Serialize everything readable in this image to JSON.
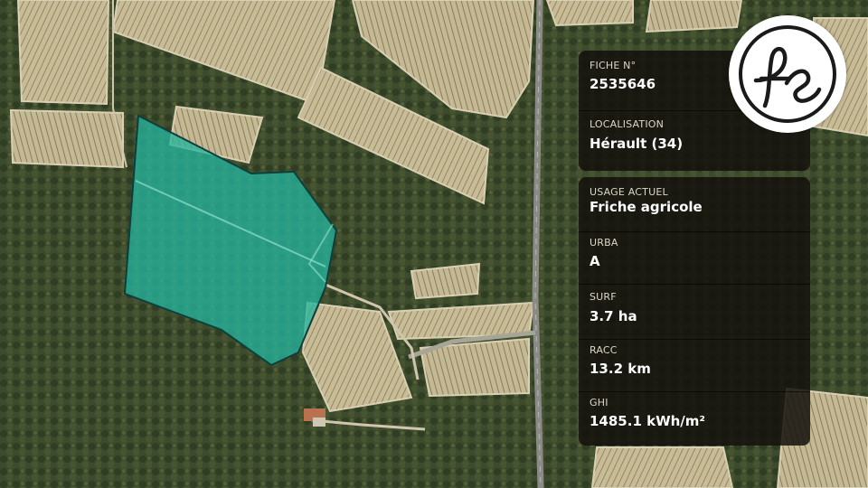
{
  "info_card": {
    "fiche": {
      "label": "FICHE N°",
      "value": "2535646"
    },
    "localisation": {
      "label": "LOCALISATION",
      "value": "Hérault (34)"
    }
  },
  "details_card": {
    "usage": {
      "label": "USAGE ACTUEL",
      "value": "Friche agricole"
    },
    "urba": {
      "label": "URBA",
      "value": "A"
    },
    "surf": {
      "label": "SURF",
      "value": "3.7 ha"
    },
    "racc": {
      "label": "RACC",
      "value": "13.2 km"
    },
    "ghi": {
      "label": "GHI",
      "value": "1485.1 kWh/m²"
    }
  },
  "logo": {
    "text": "fs"
  },
  "colors": {
    "parcel_fill": "#27b39c",
    "parcel_stroke": "#0d3f3c",
    "card_bg": "#14120e",
    "forest": "#3b4a2a"
  }
}
